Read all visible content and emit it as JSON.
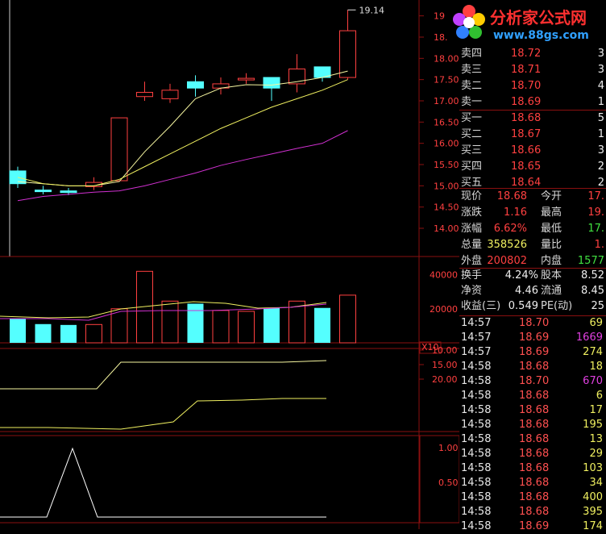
{
  "chart": {
    "high_label": "19.14",
    "price_ticks": [
      "19",
      "18.50",
      "18.00",
      "17.50",
      "17.00",
      "16.50",
      "16.00",
      "15.50",
      "15.00",
      "14.50",
      "14.00"
    ],
    "volume_ticks": [
      "40000",
      "20000"
    ],
    "volume_multiplier": "X10",
    "ind1_ticks": [
      "20.00",
      "15.00",
      "10.00"
    ],
    "ind2_ticks": [
      "1.00",
      "0.50"
    ],
    "candles": [
      {
        "o": 15.05,
        "c": 15.35,
        "h": 15.45,
        "l": 14.95,
        "up": false
      },
      {
        "o": 14.9,
        "c": 14.9,
        "h": 15.0,
        "l": 14.8,
        "up": false
      },
      {
        "o": 14.88,
        "c": 14.88,
        "h": 14.95,
        "l": 14.78,
        "up": false
      },
      {
        "o": 14.98,
        "c": 15.08,
        "h": 15.2,
        "l": 14.9,
        "up": true
      },
      {
        "o": 15.12,
        "c": 16.6,
        "h": 16.6,
        "l": 15.1,
        "up": true
      },
      {
        "o": 17.1,
        "c": 17.2,
        "h": 17.45,
        "l": 17.0,
        "up": true
      },
      {
        "o": 17.05,
        "c": 17.25,
        "h": 17.4,
        "l": 16.95,
        "up": true
      },
      {
        "o": 17.45,
        "c": 17.3,
        "h": 17.6,
        "l": 17.1,
        "up": false
      },
      {
        "o": 17.3,
        "c": 17.4,
        "h": 17.55,
        "l": 17.15,
        "up": true
      },
      {
        "o": 17.53,
        "c": 17.53,
        "h": 17.65,
        "l": 17.4,
        "up": true
      },
      {
        "o": 17.55,
        "c": 17.3,
        "h": 17.55,
        "l": 17.0,
        "up": false
      },
      {
        "o": 17.4,
        "c": 17.75,
        "h": 18.1,
        "l": 17.2,
        "up": true
      },
      {
        "o": 17.8,
        "c": 17.55,
        "h": 17.8,
        "l": 17.45,
        "up": false
      },
      {
        "o": 17.55,
        "c": 18.65,
        "h": 19.14,
        "l": 17.5,
        "up": true
      }
    ],
    "ma_yellow_light": [
      15.1,
      15.05,
      15.0,
      15.0,
      15.1,
      15.8,
      16.4,
      17.05,
      17.3,
      17.38,
      17.37,
      17.45,
      17.55,
      17.7
    ],
    "ma_yellow": [
      15.2,
      15.05,
      15.0,
      15.0,
      15.15,
      15.45,
      15.75,
      16.05,
      16.35,
      16.6,
      16.85,
      17.05,
      17.25,
      17.5
    ],
    "ma_magenta": [
      14.65,
      14.75,
      14.8,
      14.85,
      14.88,
      15.0,
      15.15,
      15.3,
      15.48,
      15.62,
      15.75,
      15.88,
      16.0,
      16.3
    ],
    "volumes": [
      {
        "v": 28000,
        "up": false
      },
      {
        "v": 22000,
        "up": false
      },
      {
        "v": 21000,
        "up": false
      },
      {
        "v": 21500,
        "up": true
      },
      {
        "v": 40000,
        "up": true
      },
      {
        "v": 84000,
        "up": true
      },
      {
        "v": 49000,
        "up": true
      },
      {
        "v": 46000,
        "up": false
      },
      {
        "v": 38000,
        "up": true
      },
      {
        "v": 37000,
        "up": true
      },
      {
        "v": 41000,
        "up": false
      },
      {
        "v": 49000,
        "up": true
      },
      {
        "v": 41000,
        "up": false
      },
      {
        "v": 56000,
        "up": true
      }
    ]
  },
  "sell": [
    {
      "label": "卖四",
      "price": "18.72",
      "qty": "3"
    },
    {
      "label": "卖三",
      "price": "18.71",
      "qty": "3"
    },
    {
      "label": "卖二",
      "price": "18.70",
      "qty": "4"
    },
    {
      "label": "卖一",
      "price": "18.69",
      "qty": "1"
    }
  ],
  "buy": [
    {
      "label": "买一",
      "price": "18.68",
      "qty": "5"
    },
    {
      "label": "买二",
      "price": "18.67",
      "qty": "1"
    },
    {
      "label": "买三",
      "price": "18.66",
      "qty": "3"
    },
    {
      "label": "买四",
      "price": "18.65",
      "qty": "2"
    },
    {
      "label": "买五",
      "price": "18.64",
      "qty": "2"
    }
  ],
  "quote": {
    "now_label": "现价",
    "now": "18.68",
    "open_label": "今开",
    "open": "17.",
    "chg_label": "涨跌",
    "chg": "1.16",
    "high_label": "最高",
    "high": "19.",
    "pct_label": "涨幅",
    "pct": "6.62%",
    "low_label": "最低",
    "low": "17.",
    "vol_label": "总量",
    "vol": "358526",
    "ratio_label": "量比",
    "ratio": "1.",
    "outer_label": "外盘",
    "outer": "200802",
    "inner_label": "内盘",
    "inner": "1577"
  },
  "fund": {
    "turn_label": "换手",
    "turn": "4.24%",
    "cap_label": "股本",
    "cap": "8.52",
    "nav_label": "净资",
    "nav": "4.46",
    "float_label": "流通",
    "float": "8.45",
    "eps_label": "收益(三)",
    "eps": "0.549",
    "pe_label": "PE(动)",
    "pe": "25"
  },
  "ticks": [
    {
      "t": "14:57",
      "p": "18.70",
      "q": "69",
      "c": "yellow"
    },
    {
      "t": "14:57",
      "p": "18.69",
      "q": "1669",
      "c": "purple"
    },
    {
      "t": "14:57",
      "p": "18.69",
      "q": "274",
      "c": "yellow"
    },
    {
      "t": "14:58",
      "p": "18.68",
      "q": "18",
      "c": "yellow"
    },
    {
      "t": "14:58",
      "p": "18.70",
      "q": "670",
      "c": "purple"
    },
    {
      "t": "14:58",
      "p": "18.68",
      "q": "6",
      "c": "yellow"
    },
    {
      "t": "14:58",
      "p": "18.68",
      "q": "17",
      "c": "yellow"
    },
    {
      "t": "14:58",
      "p": "18.68",
      "q": "195",
      "c": "yellow"
    },
    {
      "t": "14:58",
      "p": "18.68",
      "q": "13",
      "c": "yellow"
    },
    {
      "t": "14:58",
      "p": "18.68",
      "q": "29",
      "c": "yellow"
    },
    {
      "t": "14:58",
      "p": "18.68",
      "q": "103",
      "c": "yellow"
    },
    {
      "t": "14:58",
      "p": "18.68",
      "q": "34",
      "c": "yellow"
    },
    {
      "t": "14:58",
      "p": "18.68",
      "q": "400",
      "c": "yellow"
    },
    {
      "t": "14:58",
      "p": "18.68",
      "q": "395",
      "c": "yellow"
    },
    {
      "t": "14:58",
      "p": "18.69",
      "q": "174",
      "c": "yellow"
    }
  ],
  "logo": {
    "name": "分析家公式网",
    "url": "www.88gs.com"
  },
  "colors": {
    "up": "#ff4040",
    "down": "#54ffff",
    "grid": "#8a1010",
    "yellow": "#f0f060",
    "magenta": "#d030d0",
    "white": "#e8e8e8"
  }
}
